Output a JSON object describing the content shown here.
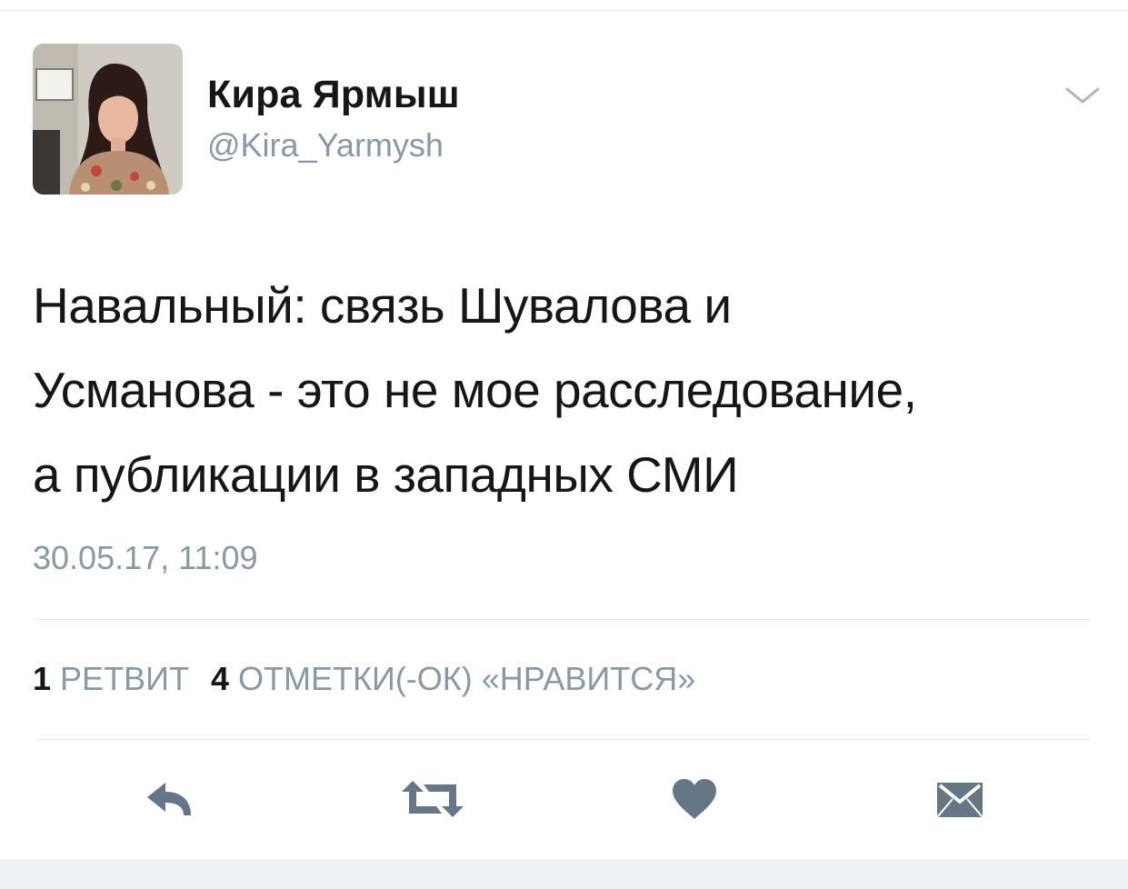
{
  "author": {
    "display_name": "Кира Ярмыш",
    "handle": "@Kira_Yarmysh"
  },
  "tweet": {
    "lines": [
      "Навальный: связь Шувалова и",
      "Усманова - это не мое расследование,",
      "а публикации в западных СМИ"
    ],
    "timestamp": "30.05.17, 11:09"
  },
  "stats": {
    "retweet_count": "1",
    "retweet_label": "РЕТВИТ",
    "likes_count": "4",
    "likes_label": "ОТМЕТКИ(-ОК) «НРАВИТСЯ»"
  },
  "actions": {
    "reply_icon": "reply-icon",
    "retweet_icon": "retweet-icon",
    "like_icon": "heart-icon",
    "dm_icon": "envelope-icon"
  },
  "colors": {
    "text_primary": "#14171a",
    "text_secondary": "#8899a6",
    "icon": "#657786",
    "divider": "#e1e8ed"
  }
}
